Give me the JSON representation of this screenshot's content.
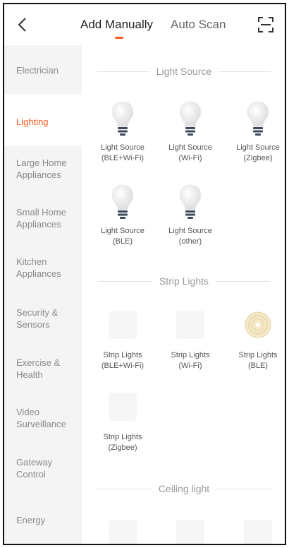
{
  "header": {
    "tabs": [
      {
        "label": "Add Manually",
        "active": true
      },
      {
        "label": "Auto Scan",
        "active": false
      }
    ],
    "accent_color": "#ff5a1f"
  },
  "sidebar": {
    "items": [
      {
        "label": "Electrician"
      },
      {
        "label": "Lighting",
        "active": true
      },
      {
        "label": "Large Home Appliances"
      },
      {
        "label": "Small Home Appliances"
      },
      {
        "label": "Kitchen Appliances"
      },
      {
        "label": "Security & Sensors"
      },
      {
        "label": "Exercise & Health"
      },
      {
        "label": "Video Surveillance"
      },
      {
        "label": "Gateway Control"
      },
      {
        "label": "Energy"
      }
    ]
  },
  "sections": [
    {
      "title": "Light Source",
      "devices": [
        {
          "line1": "Light Source",
          "line2": "(BLE+Wi-Fi)",
          "icon": "bulb-icon"
        },
        {
          "line1": "Light Source",
          "line2": "(Wi-Fi)",
          "icon": "bulb-icon"
        },
        {
          "line1": "Light Source",
          "line2": "(Zigbee)",
          "icon": "bulb-icon"
        },
        {
          "line1": "Light Source",
          "line2": "(BLE)",
          "icon": "bulb-icon"
        },
        {
          "line1": "Light Source",
          "line2": "(other)",
          "icon": "bulb-icon"
        }
      ]
    },
    {
      "title": "Strip Lights",
      "devices": [
        {
          "line1": "Strip Lights",
          "line2": "(BLE+Wi-Fi)",
          "icon": "placeholder"
        },
        {
          "line1": "Strip Lights",
          "line2": "(Wi-Fi)",
          "icon": "placeholder"
        },
        {
          "line1": "Strip Lights",
          "line2": "(BLE)",
          "icon": "strip-light-reel-icon"
        },
        {
          "line1": "Strip Lights",
          "line2": "(Zigbee)",
          "icon": "placeholder"
        }
      ]
    },
    {
      "title": "Ceiling light",
      "devices": []
    }
  ]
}
